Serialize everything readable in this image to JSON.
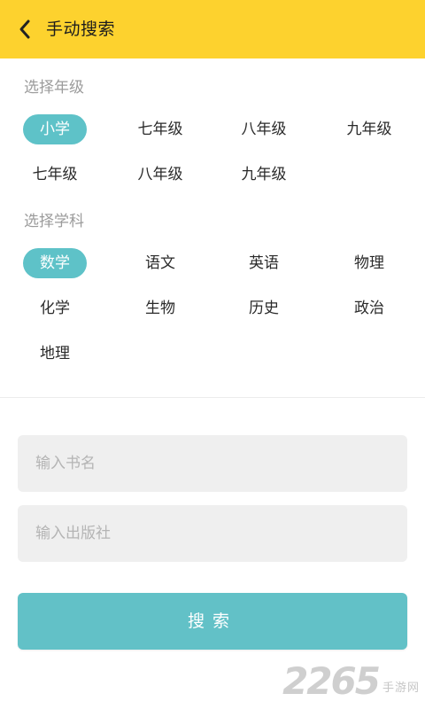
{
  "header": {
    "title": "手动搜索",
    "back_icon": "chevron-left-icon",
    "background": "#fdd22e"
  },
  "grade": {
    "label": "选择年级",
    "options": [
      "小学",
      "七年级",
      "八年级",
      "九年级",
      "七年级",
      "八年级",
      "九年级"
    ],
    "selected": "小学"
  },
  "subject": {
    "label": "选择学科",
    "options": [
      "数学",
      "语文",
      "英语",
      "物理",
      "化学",
      "生物",
      "历史",
      "政治",
      "地理"
    ],
    "selected": "数学"
  },
  "form": {
    "book_name_placeholder": "输入书名",
    "publisher_placeholder": "输入出版社",
    "book_name_value": "",
    "publisher_value": ""
  },
  "search_button": {
    "label": "搜索"
  },
  "watermark": {
    "number": "2265",
    "text": "手游网"
  },
  "colors": {
    "accent": "#5ec2c8",
    "header": "#fdd22e"
  }
}
